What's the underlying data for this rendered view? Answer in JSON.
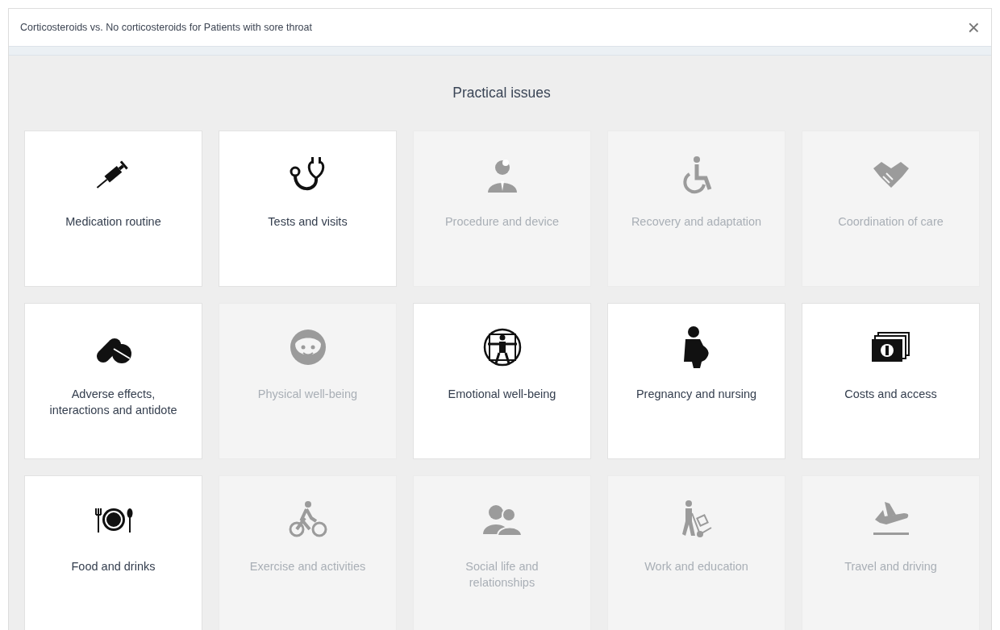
{
  "dialog": {
    "title": "Corticosteroids vs. No corticosteroids for Patients with sore throat",
    "close": "×"
  },
  "heading": "Practical issues",
  "cards": [
    {
      "label": "Medication routine",
      "disabled": false
    },
    {
      "label": "Tests and visits",
      "disabled": false
    },
    {
      "label": "Procedure and device",
      "disabled": true
    },
    {
      "label": "Recovery and adaptation",
      "disabled": true
    },
    {
      "label": "Coordination of care",
      "disabled": true
    },
    {
      "label": "Adverse effects, interactions and antidote",
      "disabled": false
    },
    {
      "label": "Physical well-being",
      "disabled": true
    },
    {
      "label": "Emotional well-being",
      "disabled": false
    },
    {
      "label": "Pregnancy and nursing",
      "disabled": false
    },
    {
      "label": "Costs and access",
      "disabled": false
    },
    {
      "label": "Food and drinks",
      "disabled": false
    },
    {
      "label": "Exercise and activities",
      "disabled": true
    },
    {
      "label": "Social life and relationships",
      "disabled": true
    },
    {
      "label": "Work and education",
      "disabled": true
    },
    {
      "label": "Travel and driving",
      "disabled": true
    }
  ]
}
